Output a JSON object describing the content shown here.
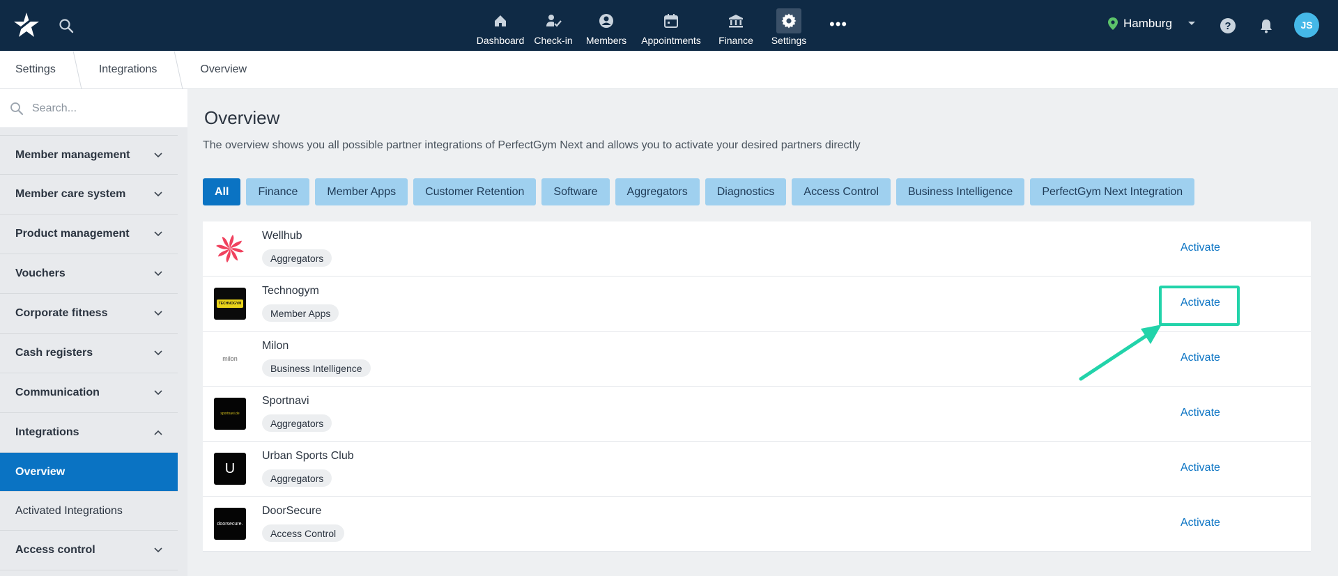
{
  "header": {
    "nav": [
      {
        "label": "Dashboard",
        "icon": "home-icon"
      },
      {
        "label": "Check-in",
        "icon": "check-in-icon"
      },
      {
        "label": "Members",
        "icon": "members-icon"
      },
      {
        "label": "Appointments",
        "icon": "calendar-icon"
      },
      {
        "label": "Finance",
        "icon": "bank-icon"
      },
      {
        "label": "Settings",
        "icon": "gear-icon",
        "active": true
      }
    ],
    "more": "•••",
    "location": "Hamburg",
    "avatar_initials": "JS"
  },
  "breadcrumb": [
    "Settings",
    "Integrations",
    "Overview"
  ],
  "sidebar": {
    "search_placeholder": "Search...",
    "items": [
      {
        "label": "Member management"
      },
      {
        "label": "Member care system"
      },
      {
        "label": "Product management"
      },
      {
        "label": "Vouchers"
      },
      {
        "label": "Corporate fitness"
      },
      {
        "label": "Cash registers"
      },
      {
        "label": "Communication"
      },
      {
        "label": "Integrations",
        "expanded": true
      }
    ],
    "subitems": [
      {
        "label": "Overview",
        "active": true
      },
      {
        "label": "Activated Integrations"
      }
    ],
    "after": [
      {
        "label": "Access control"
      }
    ]
  },
  "main": {
    "title": "Overview",
    "description": "The overview shows you all possible partner integrations of PerfectGym Next and allows you to activate your desired partners directly",
    "filters": [
      "All",
      "Finance",
      "Member Apps",
      "Customer Retention",
      "Software",
      "Aggregators",
      "Diagnostics",
      "Access Control",
      "Business Intelligence",
      "PerfectGym Next Integration"
    ],
    "active_filter": "All",
    "integrations": [
      {
        "name": "Wellhub",
        "category": "Aggregators",
        "action": "Activate",
        "logo": "wellhub-logo"
      },
      {
        "name": "Technogym",
        "category": "Member Apps",
        "action": "Activate",
        "logo": "technogym-logo",
        "logo_text": "TECHNOGYM"
      },
      {
        "name": "Milon",
        "category": "Business Intelligence",
        "action": "Activate",
        "logo": "milon-logo",
        "logo_text": "milon"
      },
      {
        "name": "Sportnavi",
        "category": "Aggregators",
        "action": "Activate",
        "logo": "sportnavi-logo",
        "logo_text": "sportnavi.de"
      },
      {
        "name": "Urban Sports Club",
        "category": "Aggregators",
        "action": "Activate",
        "logo": "urban-sports-club-logo",
        "logo_text": "U"
      },
      {
        "name": "DoorSecure",
        "category": "Access Control",
        "action": "Activate",
        "logo": "doorsecure-logo",
        "logo_text": "doorsecure."
      }
    ]
  },
  "colors": {
    "topbar": "#0f2a45",
    "accent": "#0a73c3",
    "chip": "#9fd0ef",
    "highlight": "#22d3aa"
  }
}
